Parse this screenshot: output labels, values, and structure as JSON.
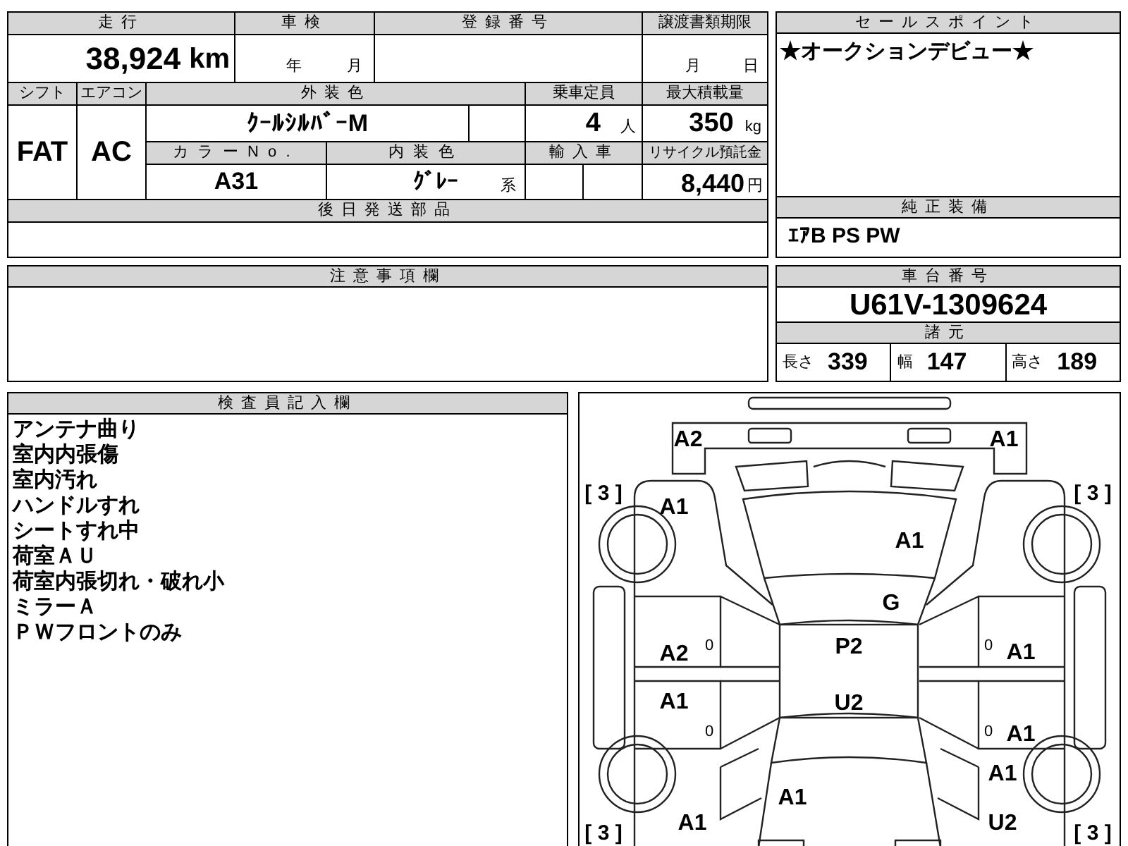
{
  "inspection_sheet": {
    "mileage": {
      "label": "走行",
      "value": "38,924",
      "unit": "km"
    },
    "shaken": {
      "label": "車検",
      "year_unit": "年",
      "month_unit": "月"
    },
    "registration_number": {
      "label": "登録番号"
    },
    "transfer_deadline": {
      "label": "譲渡書類期限",
      "month_unit": "月",
      "day_unit": "日"
    },
    "shift": {
      "label": "シフト",
      "value": "FAT"
    },
    "aircon": {
      "label": "エアコン",
      "value": "AC"
    },
    "exterior_color": {
      "label": "外装色",
      "value": "ｸｰﾙｼﾙﾊﾞｰM"
    },
    "capacity": {
      "label": "乗車定員",
      "value": "4",
      "unit": "人"
    },
    "max_load": {
      "label": "最大積載量",
      "value": "350",
      "unit": "kg"
    },
    "color_no": {
      "label": "カラーNo.",
      "value": "A31"
    },
    "interior_color": {
      "label": "内装色",
      "value": "ｸﾞﾚｰ",
      "suffix": "系"
    },
    "import": {
      "label": "輸入車"
    },
    "recycle_fee": {
      "label": "リサイクル預託金",
      "value": "8,440",
      "unit": "円"
    },
    "parts_later": {
      "label": "後日発送部品"
    },
    "sales_point": {
      "label": "セールスポイント",
      "text": "★オークションデビュー★"
    },
    "equipment": {
      "label": "純正装備",
      "text": "ｴｱB PS PW"
    },
    "notes": {
      "label": "注意事項欄"
    },
    "chassis_number": {
      "label": "車台番号",
      "value": "U61V-1309624"
    },
    "specs": {
      "label": "諸元",
      "items": [
        {
          "label": "長さ",
          "value": "339"
        },
        {
          "label": "幅",
          "value": "147"
        },
        {
          "label": "高さ",
          "value": "189"
        }
      ]
    },
    "inspector_notes": {
      "label": "検査員記入欄",
      "lines": [
        "アンテナ曲り",
        "室内内張傷",
        "室内汚れ",
        "ハンドルすれ",
        "シートすれ中",
        "荷室ＡＵ",
        "荷室内張切れ・破れ小",
        "ミラーＡ",
        "ＰＷフロントのみ"
      ]
    },
    "diagram": {
      "tire_marks": [
        "[ 3 ]",
        "[ 3 ]",
        "[ 3 ]",
        "[ 3 ]"
      ],
      "door_marks": [
        "0",
        "0",
        "0",
        "0"
      ],
      "damage_marks": [
        {
          "code": "A2"
        },
        {
          "code": "A1"
        },
        {
          "code": "A1"
        },
        {
          "code": "A1"
        },
        {
          "code": "G"
        },
        {
          "code": "A2"
        },
        {
          "code": "P2"
        },
        {
          "code": "A1"
        },
        {
          "code": "A1"
        },
        {
          "code": "U2"
        },
        {
          "code": "A1"
        },
        {
          "code": "A1"
        },
        {
          "code": "A1"
        },
        {
          "code": "A1"
        },
        {
          "code": "U2"
        }
      ]
    }
  }
}
